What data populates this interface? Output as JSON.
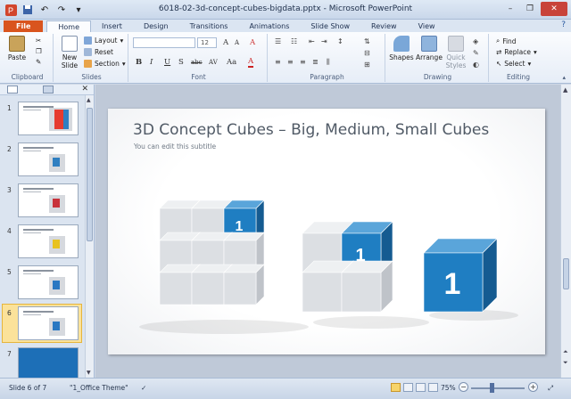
{
  "window": {
    "title": "6018-02-3d-concept-cubes-bigdata.pptx - Microsoft PowerPoint",
    "qat_icons": [
      "powerpoint-logo-icon",
      "save-icon",
      "undo-icon",
      "redo-icon",
      "customize-icon"
    ]
  },
  "tabs": [
    "File",
    "Home",
    "Insert",
    "Design",
    "Transitions",
    "Animations",
    "Slide Show",
    "Review",
    "View"
  ],
  "active_tab": "Home",
  "ribbon": {
    "clipboard": {
      "paste": "Paste",
      "label": "Clipboard"
    },
    "slides": {
      "new_slide": "New Slide",
      "layout": "Layout",
      "reset": "Reset",
      "section": "Section",
      "label": "Slides"
    },
    "font": {
      "size": "12",
      "label": "Font",
      "bold": "B",
      "italic": "I",
      "underline": "U",
      "strike": "S",
      "shadow": "abc",
      "spacing": "AV",
      "case": "Aa",
      "grow": "A",
      "shrink": "A",
      "clear": "A"
    },
    "paragraph": {
      "label": "Paragraph"
    },
    "drawing": {
      "shapes": "Shapes",
      "arrange": "Arrange",
      "quick_styles": "Quick Styles",
      "label": "Drawing"
    },
    "editing": {
      "find": "Find",
      "replace": "Replace",
      "select": "Select",
      "label": "Editing"
    }
  },
  "slides_pane": {
    "numbers": [
      "1",
      "2",
      "3",
      "4",
      "5",
      "6",
      "7"
    ],
    "selected": "6",
    "thumb_accents": [
      "#e63b2e",
      "#2f7fc1",
      "#c8323a",
      "#e8c21f",
      "#2a78c2",
      "#2a78c2",
      "#1d6fb7"
    ]
  },
  "slide": {
    "title": "3D Concept Cubes – Big, Medium, Small Cubes",
    "subtitle": "You can edit this subtitle",
    "cube_label": "1",
    "accent_color": "#1f7ec2"
  },
  "status": {
    "slide": "Slide 6 of 7",
    "theme": "\"1_Office Theme\"",
    "zoom": "75%"
  }
}
